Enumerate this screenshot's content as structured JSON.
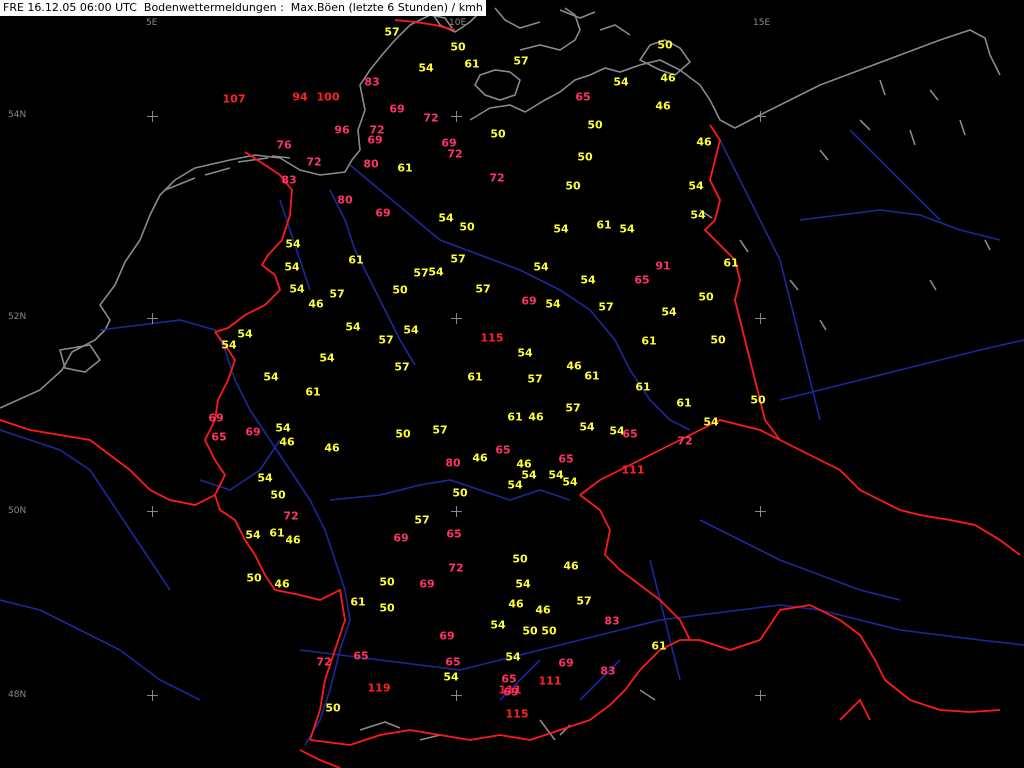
{
  "header": {
    "title": "FRE 16.12.05 06:00 UTC  Bodenwettermeldungen :  Max.Böen (letzte 6 Stunden) / kmh"
  },
  "map": {
    "colors": {
      "background": "#000000",
      "coast": "#8a8a8a",
      "rivers": "#1a2a9a",
      "borders": "#ff1a1a",
      "grid": "#888888",
      "value_low": "#ffff33",
      "value_high": "#ff3366",
      "value_extreme": "#ff2222"
    },
    "units": "kmh",
    "lon_labels": [
      "5E",
      "10E",
      "15E"
    ],
    "lat_labels": [
      "54N",
      "52N",
      "50N",
      "48N"
    ]
  },
  "observations": [
    {
      "v": "57",
      "c": "low"
    },
    {
      "v": "50",
      "c": "low"
    },
    {
      "v": "54",
      "c": "low"
    },
    {
      "v": "61",
      "c": "low"
    },
    {
      "v": "57",
      "c": "low"
    },
    {
      "v": "50",
      "c": "low"
    },
    {
      "v": "54",
      "c": "low"
    },
    {
      "v": "46",
      "c": "low"
    },
    {
      "v": "83",
      "c": "high"
    },
    {
      "v": "107",
      "c": "extreme"
    },
    {
      "v": "94",
      "c": "extreme"
    },
    {
      "v": "100",
      "c": "extreme"
    },
    {
      "v": "69",
      "c": "high"
    },
    {
      "v": "72",
      "c": "high"
    },
    {
      "v": "65",
      "c": "high"
    },
    {
      "v": "46",
      "c": "low"
    },
    {
      "v": "50",
      "c": "low"
    },
    {
      "v": "50",
      "c": "low"
    },
    {
      "v": "96",
      "c": "high"
    },
    {
      "v": "72",
      "c": "high"
    },
    {
      "v": "69",
      "c": "high"
    },
    {
      "v": "69",
      "c": "high"
    },
    {
      "v": "72",
      "c": "high"
    },
    {
      "v": "46",
      "c": "low"
    },
    {
      "v": "76",
      "c": "high"
    },
    {
      "v": "72",
      "c": "high"
    },
    {
      "v": "80",
      "c": "high"
    },
    {
      "v": "61",
      "c": "low"
    },
    {
      "v": "50",
      "c": "low"
    },
    {
      "v": "83",
      "c": "high"
    },
    {
      "v": "72",
      "c": "high"
    },
    {
      "v": "50",
      "c": "low"
    },
    {
      "v": "54",
      "c": "low"
    },
    {
      "v": "80",
      "c": "high"
    },
    {
      "v": "69",
      "c": "high"
    },
    {
      "v": "54",
      "c": "low"
    },
    {
      "v": "50",
      "c": "low"
    },
    {
      "v": "61",
      "c": "low"
    },
    {
      "v": "54",
      "c": "low"
    },
    {
      "v": "54",
      "c": "low"
    },
    {
      "v": "54",
      "c": "low"
    },
    {
      "v": "61",
      "c": "low"
    },
    {
      "v": "57",
      "c": "low"
    },
    {
      "v": "54",
      "c": "low"
    },
    {
      "v": "57",
      "c": "low"
    },
    {
      "v": "54",
      "c": "low"
    },
    {
      "v": "91",
      "c": "high"
    },
    {
      "v": "61",
      "c": "low"
    },
    {
      "v": "54",
      "c": "low"
    },
    {
      "v": "57",
      "c": "low"
    },
    {
      "v": "50",
      "c": "low"
    },
    {
      "v": "57",
      "c": "low"
    },
    {
      "v": "69",
      "c": "high"
    },
    {
      "v": "54",
      "c": "low"
    },
    {
      "v": "54",
      "c": "low"
    },
    {
      "v": "65",
      "c": "high"
    },
    {
      "v": "50",
      "c": "low"
    },
    {
      "v": "54",
      "c": "low"
    },
    {
      "v": "46",
      "c": "low"
    },
    {
      "v": "54",
      "c": "low"
    },
    {
      "v": "54",
      "c": "low"
    },
    {
      "v": "54",
      "c": "low"
    },
    {
      "v": "54",
      "c": "low"
    },
    {
      "v": "57",
      "c": "low"
    },
    {
      "v": "115",
      "c": "extreme"
    },
    {
      "v": "54",
      "c": "low"
    },
    {
      "v": "54",
      "c": "low"
    },
    {
      "v": "50",
      "c": "low"
    },
    {
      "v": "54",
      "c": "low"
    },
    {
      "v": "54",
      "c": "low"
    },
    {
      "v": "57",
      "c": "low"
    },
    {
      "v": "46",
      "c": "low"
    },
    {
      "v": "61",
      "c": "low"
    },
    {
      "v": "57",
      "c": "low"
    },
    {
      "v": "54",
      "c": "low"
    },
    {
      "v": "61",
      "c": "low"
    },
    {
      "v": "61",
      "c": "low"
    },
    {
      "v": "57",
      "c": "low"
    },
    {
      "v": "61",
      "c": "low"
    },
    {
      "v": "61",
      "c": "low"
    },
    {
      "v": "61",
      "c": "low"
    },
    {
      "v": "69",
      "c": "high"
    },
    {
      "v": "57",
      "c": "low"
    },
    {
      "v": "54",
      "c": "low"
    },
    {
      "v": "65",
      "c": "high"
    },
    {
      "v": "69",
      "c": "high"
    },
    {
      "v": "54",
      "c": "low"
    },
    {
      "v": "46",
      "c": "low"
    },
    {
      "v": "46",
      "c": "low"
    },
    {
      "v": "50",
      "c": "low"
    },
    {
      "v": "57",
      "c": "low"
    },
    {
      "v": "65",
      "c": "high"
    },
    {
      "v": "72",
      "c": "high"
    },
    {
      "v": "54",
      "c": "low"
    },
    {
      "v": "54",
      "c": "low"
    },
    {
      "v": "50",
      "c": "low"
    },
    {
      "v": "80",
      "c": "high"
    },
    {
      "v": "46",
      "c": "low"
    },
    {
      "v": "61",
      "c": "low"
    },
    {
      "v": "65",
      "c": "high"
    },
    {
      "v": "46",
      "c": "low"
    },
    {
      "v": "46",
      "c": "low"
    },
    {
      "v": "54",
      "c": "low"
    },
    {
      "v": "54",
      "c": "low"
    },
    {
      "v": "54",
      "c": "low"
    },
    {
      "v": "54",
      "c": "low"
    },
    {
      "v": "111",
      "c": "extreme"
    },
    {
      "v": "54",
      "c": "low"
    },
    {
      "v": "65",
      "c": "high"
    },
    {
      "v": "50",
      "c": "low"
    },
    {
      "v": "72",
      "c": "high"
    },
    {
      "v": "50",
      "c": "low"
    },
    {
      "v": "61",
      "c": "low"
    },
    {
      "v": "46",
      "c": "low"
    },
    {
      "v": "57",
      "c": "low"
    },
    {
      "v": "69",
      "c": "high"
    },
    {
      "v": "65",
      "c": "high"
    },
    {
      "v": "72",
      "c": "high"
    },
    {
      "v": "50",
      "c": "low"
    },
    {
      "v": "46",
      "c": "low"
    },
    {
      "v": "54",
      "c": "low"
    },
    {
      "v": "50",
      "c": "low"
    },
    {
      "v": "69",
      "c": "high"
    },
    {
      "v": "61",
      "c": "low"
    },
    {
      "v": "54",
      "c": "low"
    },
    {
      "v": "46",
      "c": "low"
    },
    {
      "v": "50",
      "c": "low"
    },
    {
      "v": "46",
      "c": "low"
    },
    {
      "v": "46",
      "c": "low"
    },
    {
      "v": "57",
      "c": "low"
    },
    {
      "v": "54",
      "c": "low"
    },
    {
      "v": "50",
      "c": "low"
    },
    {
      "v": "50",
      "c": "low"
    },
    {
      "v": "83",
      "c": "high"
    },
    {
      "v": "50",
      "c": "low"
    },
    {
      "v": "69",
      "c": "high"
    },
    {
      "v": "65",
      "c": "high"
    },
    {
      "v": "65",
      "c": "high"
    },
    {
      "v": "54",
      "c": "low"
    },
    {
      "v": "65",
      "c": "high"
    },
    {
      "v": "54",
      "c": "low"
    },
    {
      "v": "69",
      "c": "high"
    },
    {
      "v": "72",
      "c": "high"
    },
    {
      "v": "61",
      "c": "low"
    },
    {
      "v": "83",
      "c": "high"
    },
    {
      "v": "111",
      "c": "extreme"
    },
    {
      "v": "111",
      "c": "extreme"
    },
    {
      "v": "119",
      "c": "extreme"
    },
    {
      "v": "69",
      "c": "high"
    },
    {
      "v": "50",
      "c": "low"
    },
    {
      "v": "115",
      "c": "extreme"
    }
  ]
}
